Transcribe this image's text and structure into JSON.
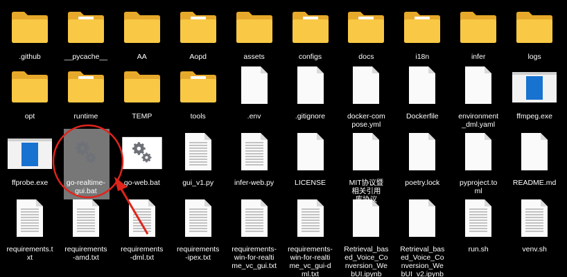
{
  "colors": {
    "background": "#000000",
    "label": "#ffffff",
    "folder_body": "#F9C845",
    "folder_back": "#E7A92B",
    "paper": "#FAFAFA",
    "page_lines": "#A0A0A0",
    "selection": "#777777",
    "annotation_red": "#E0241B"
  },
  "files": [
    {
      "label": ".github",
      "icon": "folder-icon"
    },
    {
      "label": "__pycache__",
      "icon": "folder-with-content-icon"
    },
    {
      "label": "AA",
      "icon": "folder-icon"
    },
    {
      "label": "Aopd",
      "icon": "folder-with-image-icon"
    },
    {
      "label": "assets",
      "icon": "folder-icon"
    },
    {
      "label": "configs",
      "icon": "folder-with-content-icon"
    },
    {
      "label": "docs",
      "icon": "folder-with-docs-icon"
    },
    {
      "label": "i18n",
      "icon": "folder-with-content-icon"
    },
    {
      "label": "infer",
      "icon": "folder-icon"
    },
    {
      "label": "logs",
      "icon": "folder-icon"
    },
    {
      "label": "opt",
      "icon": "folder-icon"
    },
    {
      "label": "runtime",
      "icon": "folder-with-content-icon"
    },
    {
      "label": "TEMP",
      "icon": "folder-icon"
    },
    {
      "label": "tools",
      "icon": "folder-with-content-icon"
    },
    {
      "label": ".env",
      "icon": "blank-file-icon"
    },
    {
      "label": ".gitignore",
      "icon": "blank-file-icon"
    },
    {
      "label": "docker-compose.yml",
      "icon": "blank-file-icon"
    },
    {
      "label": "Dockerfile",
      "icon": "blank-file-icon"
    },
    {
      "label": "environment_dml.yaml",
      "icon": "blank-file-icon"
    },
    {
      "label": "ffmpeg.exe",
      "icon": "exe-window-icon"
    },
    {
      "label": "ffprobe.exe",
      "icon": "exe-window-icon"
    },
    {
      "label": "go-realtime-gui.bat",
      "icon": "gears-icon",
      "selected": true
    },
    {
      "label": "go-web.bat",
      "icon": "gears-icon"
    },
    {
      "label": "gui_v1.py",
      "icon": "text-file-icon"
    },
    {
      "label": "infer-web.py",
      "icon": "text-file-icon"
    },
    {
      "label": "LICENSE",
      "icon": "blank-file-icon"
    },
    {
      "label": "MIT协议暨相关引用库协议",
      "icon": "blank-file-icon"
    },
    {
      "label": "poetry.lock",
      "icon": "blank-file-icon"
    },
    {
      "label": "pyproject.toml",
      "icon": "blank-file-icon"
    },
    {
      "label": "README.md",
      "icon": "blank-file-icon"
    },
    {
      "label": "requirements.txt",
      "icon": "text-file-icon"
    },
    {
      "label": "requirements-amd.txt",
      "icon": "text-file-icon"
    },
    {
      "label": "requirements-dml.txt",
      "icon": "text-file-icon"
    },
    {
      "label": "requirements-ipex.txt",
      "icon": "text-file-icon"
    },
    {
      "label": "requirements-win-for-realtime_vc_gui.txt",
      "icon": "text-file-icon"
    },
    {
      "label": "requirements-win-for-realtime_vc_gui-dml.txt",
      "icon": "text-file-icon"
    },
    {
      "label": "Retrieval_based_Voice_Conversion_WebUI.ipynb",
      "icon": "blank-file-icon"
    },
    {
      "label": "Retrieval_based_Voice_Conversion_WebUI_v2.ipynb",
      "icon": "blank-file-icon"
    },
    {
      "label": "run.sh",
      "icon": "text-file-icon"
    },
    {
      "label": "venv.sh",
      "icon": "text-file-icon"
    }
  ]
}
